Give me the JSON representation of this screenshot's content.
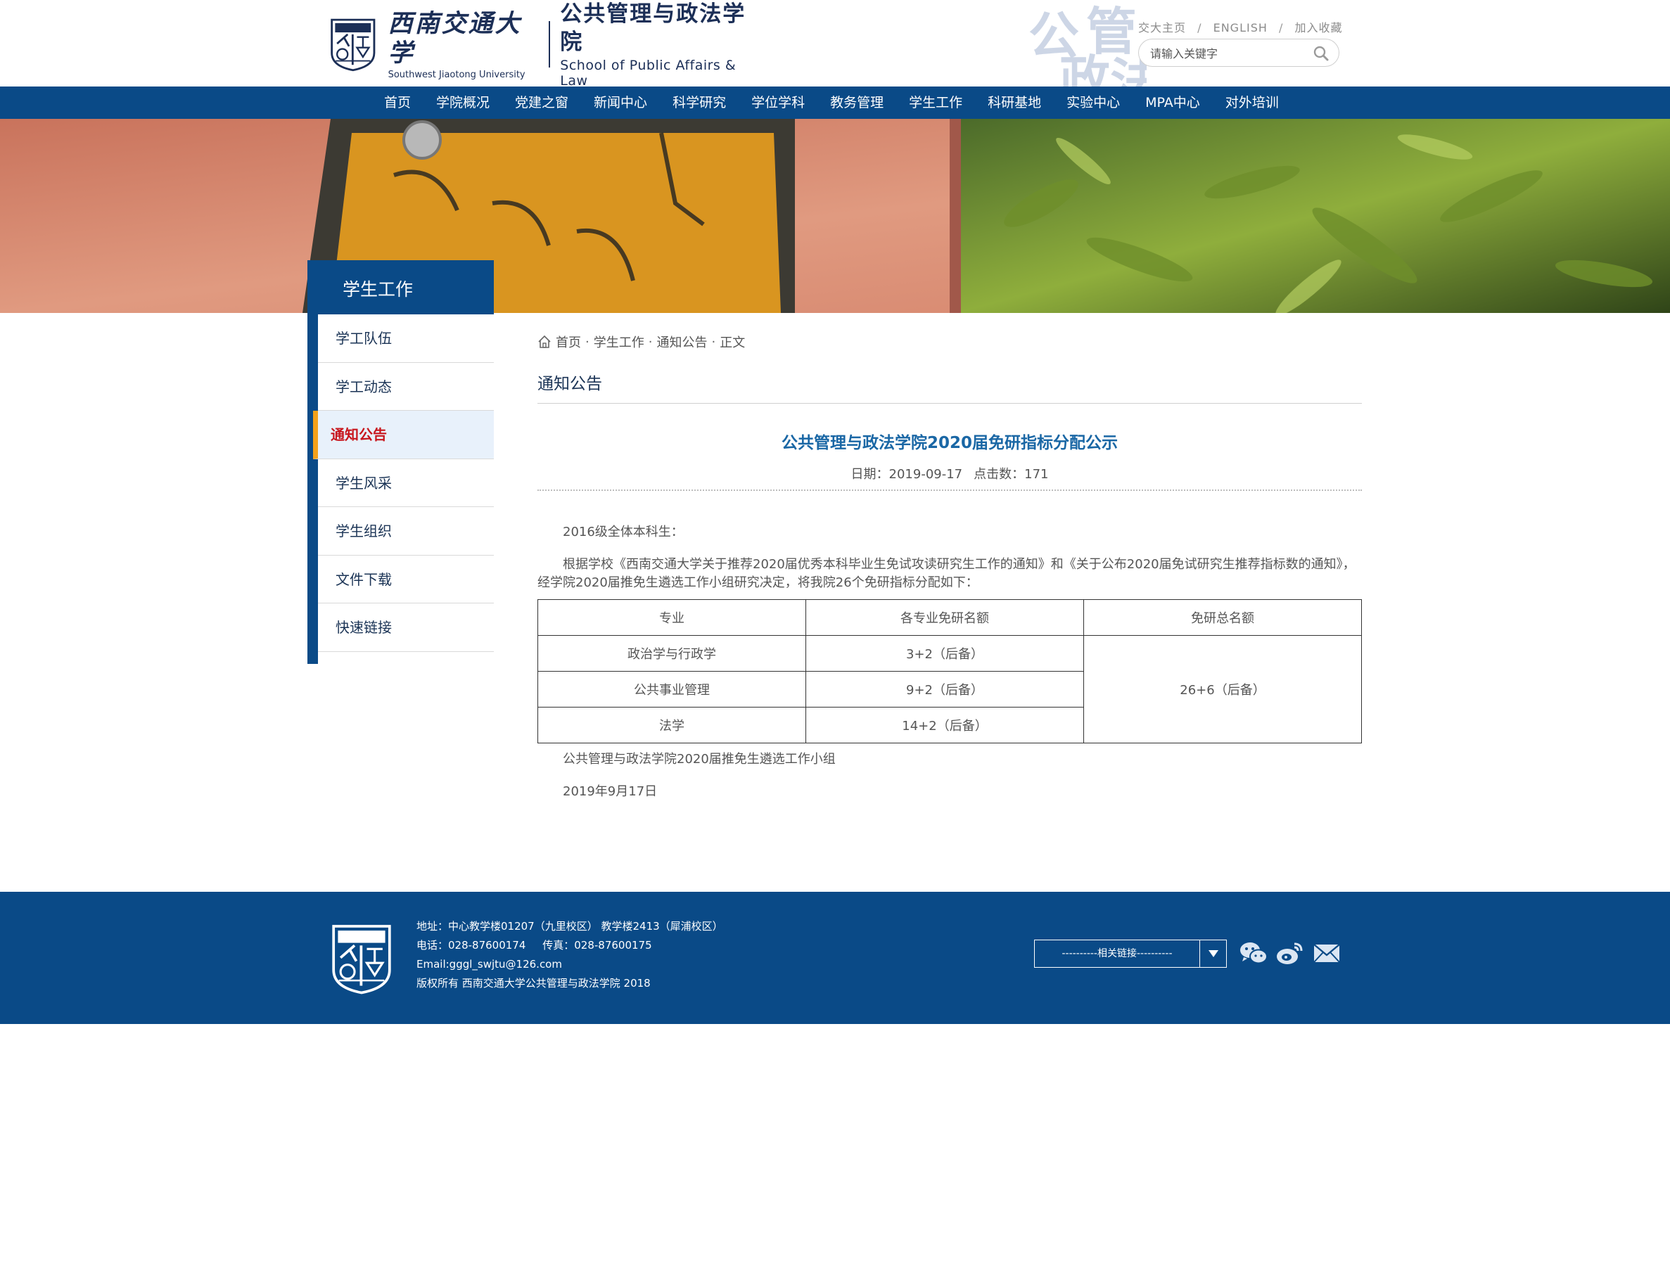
{
  "header": {
    "university_cn": "西南交通大学",
    "university_en": "Southwest Jiaotong University",
    "school_cn": "公共管理与政法学院",
    "school_en": "School of Public Affairs & Law",
    "watermark_chars": [
      "公",
      "管",
      "政",
      "法"
    ],
    "links": [
      "交大主页",
      "ENGLISH",
      "加入收藏"
    ],
    "link_separator": "/",
    "search_placeholder": "请输入关键字",
    "search_icon": "search-icon"
  },
  "nav": {
    "items": [
      "首页",
      "学院概况",
      "党建之窗",
      "新闻中心",
      "科学研究",
      "学位学科",
      "教务管理",
      "学生工作",
      "科研基地",
      "实验中心",
      "MPA中心",
      "对外培训"
    ]
  },
  "sidebar": {
    "title": "学生工作",
    "items": [
      {
        "label": "学工队伍",
        "active": false
      },
      {
        "label": "学工动态",
        "active": false
      },
      {
        "label": "通知公告",
        "active": true
      },
      {
        "label": "学生风采",
        "active": false
      },
      {
        "label": "学生组织",
        "active": false
      },
      {
        "label": "文件下载",
        "active": false
      },
      {
        "label": "快速链接",
        "active": false
      }
    ]
  },
  "breadcrumb": {
    "icon": "home-icon",
    "items": [
      "首页",
      "学生工作",
      "通知公告",
      "正文"
    ],
    "separator": "·"
  },
  "section_title": "通知公告",
  "article": {
    "title": "公共管理与政法学院2020届免研指标分配公示",
    "date_label": "日期：",
    "date": "2019-09-17",
    "hits_label": "点击数：",
    "hits": "171",
    "greeting": "2016级全体本科生：",
    "body": "根据学校《西南交通大学关于推荐2020届优秀本科毕业生免试攻读研究生工作的通知》和《关于公布2020届免试研究生推荐指标数的通知》，经学院2020届推免生遴选工作小组研究决定，将我院26个免研指标分配如下：",
    "table": {
      "headers": [
        "专业",
        "各专业免研名额",
        "免研总名额"
      ],
      "rows": [
        {
          "major": "政治学与行政学",
          "quota": "3+2（后备）"
        },
        {
          "major": "公共事业管理",
          "quota": "9+2（后备）"
        },
        {
          "major": "法学",
          "quota": "14+2（后备）"
        }
      ],
      "total": "26+6（后备）"
    },
    "signature": "公共管理与政法学院2020届推免生遴选工作小组",
    "sign_date": "2019年9月17日"
  },
  "footer": {
    "address": "地址：中心教学楼01207（九里校区） 教学楼2413（犀浦校区）",
    "phone": "电话：028-87600174     传真：028-87600175",
    "email": "Email:gggl_swjtu@126.com",
    "copyright": "版权所有 西南交通大学公共管理与政法学院 2018",
    "select_label": "----------相关链接----------",
    "icons": [
      "wechat-icon",
      "weibo-icon",
      "mail-icon"
    ]
  },
  "colors": {
    "primary": "#0a4a87",
    "accent": "#f4a11b",
    "active_text": "#c8161d",
    "title_blue": "#1a67a5"
  }
}
